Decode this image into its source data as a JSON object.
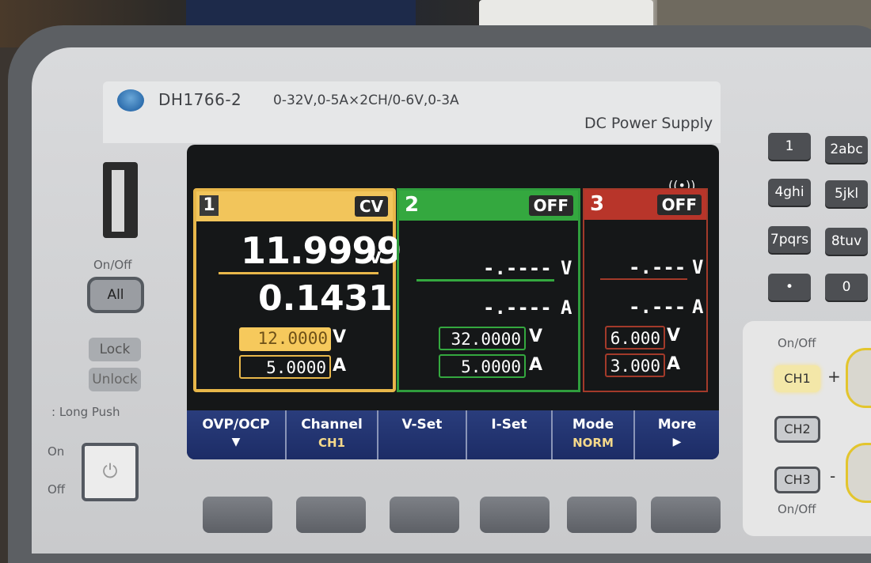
{
  "header": {
    "model": "DH1766-2",
    "spec": "0-32V,0-5A×2CH/0-6V,0-3A",
    "product_type": "DC Power Supply"
  },
  "left_controls": {
    "onoff_label": "On/Off",
    "all_label": "All",
    "lock_label": "Lock",
    "unlock_label": "Unlock",
    "long_push_label": ": Long Push",
    "on_label": "On",
    "off_label": "Off"
  },
  "channels": [
    {
      "number": "1",
      "state": "CV",
      "voltage": "11.9999",
      "voltage_unit": "V",
      "current": "0.1431",
      "v_set": "12.0000",
      "i_set": "5.0000",
      "v_unit": "V",
      "a_unit": "A",
      "color": "#f2c55b"
    },
    {
      "number": "2",
      "state": "OFF",
      "voltage": "-.----",
      "voltage_unit": "V",
      "current": "-.----",
      "current_unit": "A",
      "v_set": "32.0000",
      "i_set": "5.0000",
      "v_unit": "V",
      "a_unit": "A",
      "color": "#34a83f"
    },
    {
      "number": "3",
      "state": "OFF",
      "voltage": "-.---",
      "voltage_unit": "V",
      "current": "-.---",
      "current_unit": "A",
      "v_set": "6.000",
      "i_set": "3.000",
      "v_unit": "V",
      "a_unit": "A",
      "color": "#b8352a"
    }
  ],
  "softkeys": [
    {
      "label": "OVP/OCP",
      "sub": "▼"
    },
    {
      "label": "Channel",
      "sub": "CH1"
    },
    {
      "label": "V-Set",
      "sub": ""
    },
    {
      "label": "I-Set",
      "sub": ""
    },
    {
      "label": "Mode",
      "sub": "NORM"
    },
    {
      "label": "More",
      "sub": "▶"
    }
  ],
  "keypad": [
    "1",
    "2abc",
    "4ghi",
    "5jkl",
    "7pqrs",
    "8tuv",
    "•",
    "0"
  ],
  "channel_buttons": {
    "onoff_top": "On/Off",
    "onoff_bottom": "On/Off",
    "ch1": "CH1",
    "ch2": "CH2",
    "ch3": "CH3",
    "plus": "+",
    "minus": "-"
  },
  "icons": {
    "beep": "speaker-icon",
    "power": "power-icon"
  }
}
